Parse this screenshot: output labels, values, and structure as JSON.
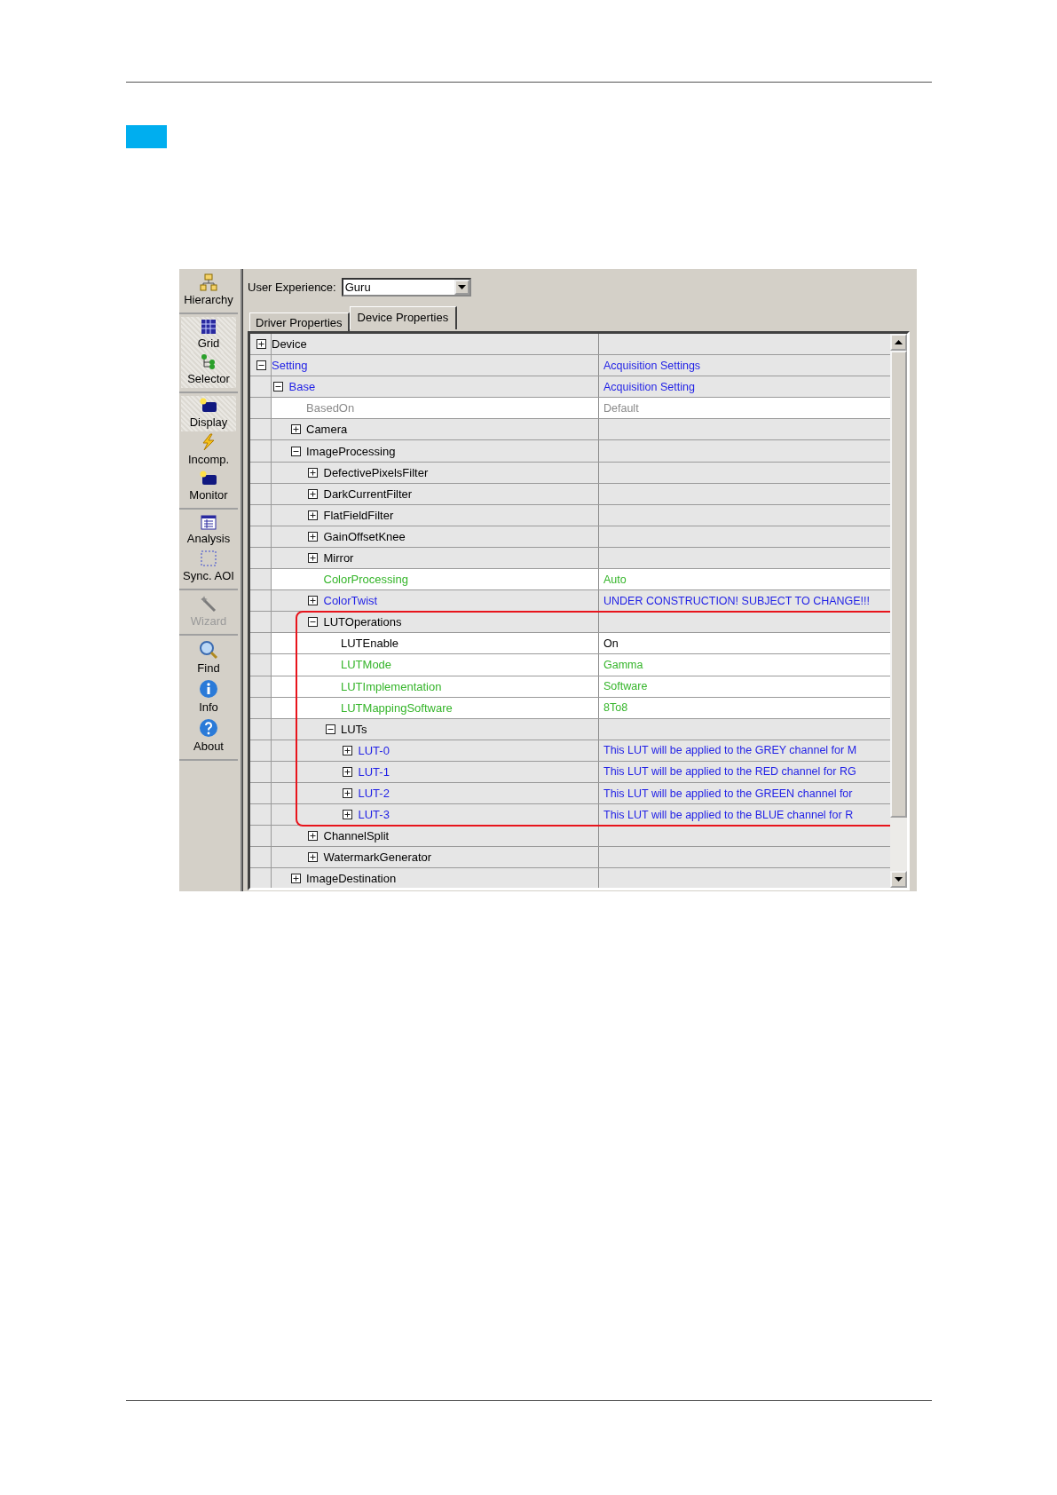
{
  "sidebar": {
    "groups": [
      {
        "items": [
          {
            "label": "Hierarchy",
            "active": false,
            "disabled": false
          }
        ]
      },
      {
        "items": [
          {
            "label": "Grid",
            "active": true,
            "disabled": false
          },
          {
            "label": "Selector",
            "active": true,
            "disabled": false
          }
        ]
      },
      {
        "items": [
          {
            "label": "Display",
            "active": true,
            "disabled": false
          },
          {
            "label": "Incomp.",
            "active": false,
            "disabled": false
          },
          {
            "label": "Monitor",
            "active": false,
            "disabled": false
          }
        ]
      },
      {
        "items": [
          {
            "label": "Analysis",
            "active": false,
            "disabled": false
          },
          {
            "label": "Sync. AOI",
            "active": false,
            "disabled": false
          }
        ]
      },
      {
        "items": [
          {
            "label": "Wizard",
            "active": false,
            "disabled": true
          }
        ]
      },
      {
        "items": [
          {
            "label": "Find",
            "active": false,
            "disabled": false
          },
          {
            "label": "Info",
            "active": false,
            "disabled": false
          },
          {
            "label": "About",
            "active": false,
            "disabled": false
          }
        ]
      }
    ]
  },
  "user_experience": {
    "label": "User Experience:",
    "value": "Guru"
  },
  "tabs": [
    {
      "label": "Driver Properties",
      "selected": false
    },
    {
      "label": "Device Properties",
      "selected": true
    }
  ],
  "tree": [
    {
      "name": "Device",
      "expanded": false,
      "color": "#000000"
    },
    {
      "name": "Setting",
      "expanded": true,
      "color": "#1f1fe6",
      "value": "Acquisition Settings",
      "children": [
        {
          "name": "Base",
          "expanded": true,
          "color": "#1f1fe6",
          "value": "Acquisition Setting",
          "children": [
            {
              "name": "BasedOn",
              "color": "#8a8a8a",
              "value": "Default"
            },
            {
              "name": "Camera",
              "expanded": false,
              "color": "#000000"
            },
            {
              "name": "ImageProcessing",
              "expanded": true,
              "color": "#000000",
              "children": [
                {
                  "name": "DefectivePixelsFilter",
                  "expanded": false,
                  "color": "#000000"
                },
                {
                  "name": "DarkCurrentFilter",
                  "expanded": false,
                  "color": "#000000"
                },
                {
                  "name": "FlatFieldFilter",
                  "expanded": false,
                  "color": "#000000"
                },
                {
                  "name": "GainOffsetKnee",
                  "expanded": false,
                  "color": "#000000"
                },
                {
                  "name": "Mirror",
                  "expanded": false,
                  "color": "#000000"
                },
                {
                  "name": "ColorProcessing",
                  "color": "#35b52a",
                  "value": "Auto"
                },
                {
                  "name": "ColorTwist",
                  "expanded": false,
                  "color": "#1f1fe6",
                  "value": "UNDER CONSTRUCTION! SUBJECT TO CHANGE!!!"
                },
                {
                  "name": "LUTOperations",
                  "expanded": true,
                  "color": "#000000",
                  "highlighted": true,
                  "children": [
                    {
                      "name": "LUTEnable",
                      "color": "#000000",
                      "value": "On"
                    },
                    {
                      "name": "LUTMode",
                      "color": "#35b52a",
                      "value": "Gamma"
                    },
                    {
                      "name": "LUTImplementation",
                      "color": "#35b52a",
                      "value": "Software"
                    },
                    {
                      "name": "LUTMappingSoftware",
                      "color": "#35b52a",
                      "value": "8To8"
                    },
                    {
                      "name": "LUTs",
                      "expanded": true,
                      "color": "#000000",
                      "children": [
                        {
                          "name": "LUT-0",
                          "expanded": false,
                          "color": "#1f1fe6",
                          "value": "This LUT will be applied to the GREY channel for M"
                        },
                        {
                          "name": "LUT-1",
                          "expanded": false,
                          "color": "#1f1fe6",
                          "value": "This LUT will be applied to the RED channel for RG"
                        },
                        {
                          "name": "LUT-2",
                          "expanded": false,
                          "color": "#1f1fe6",
                          "value": "This LUT will be applied to the GREEN channel for"
                        },
                        {
                          "name": "LUT-3",
                          "expanded": false,
                          "color": "#1f1fe6",
                          "value": "This LUT will be applied to the BLUE channel for R"
                        }
                      ]
                    }
                  ]
                },
                {
                  "name": "ChannelSplit",
                  "expanded": false,
                  "color": "#000000"
                },
                {
                  "name": "WatermarkGenerator",
                  "expanded": false,
                  "color": "#000000"
                }
              ]
            },
            {
              "name": "ImageDestination",
              "expanded": false,
              "color": "#000000"
            }
          ]
        }
      ]
    }
  ]
}
